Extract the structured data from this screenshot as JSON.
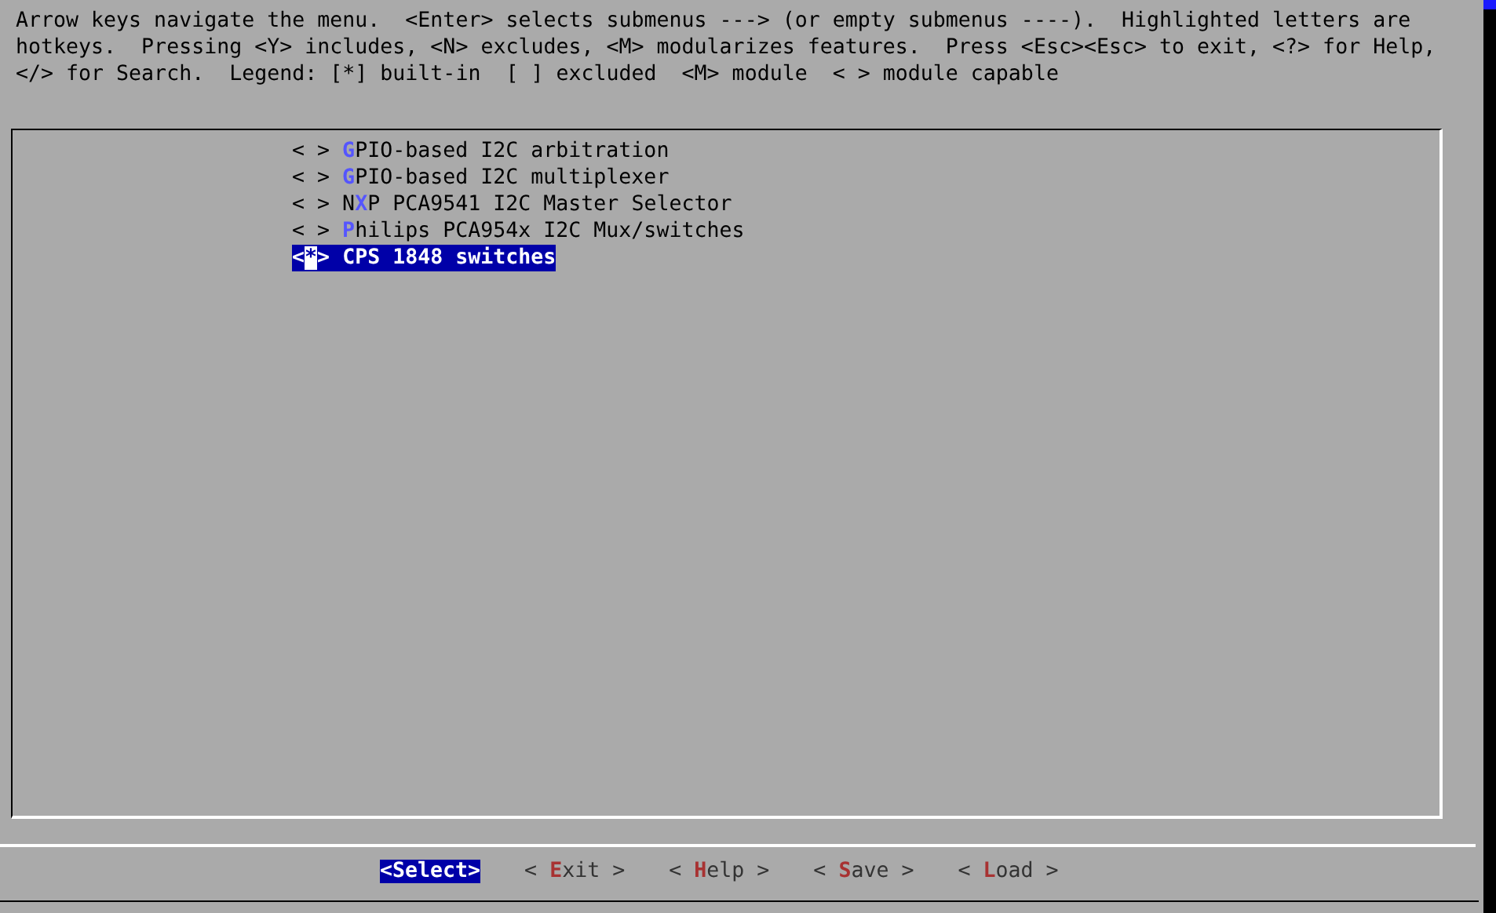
{
  "help_text": [
    "Arrow keys navigate the menu.  <Enter> selects submenus ---> (or empty submenus ----).  Highlighted letters are",
    "hotkeys.  Pressing <Y> includes, <N> excludes, <M> modularizes features.  Press <Esc><Esc> to exit, <?> for Help,",
    "</> for Search.  Legend: [*] built-in  [ ] excluded  <M> module  < > module capable"
  ],
  "menu_items": [
    {
      "marker": "< >",
      "hotkey": "G",
      "after": "PIO-based I2C arbitration",
      "selected": false
    },
    {
      "marker": "< >",
      "hotkey": "G",
      "after": "PIO-based I2C multiplexer",
      "selected": false
    },
    {
      "marker": "< >",
      "before": "N",
      "hotkey": "X",
      "after": "P PCA9541 I2C Master Selector",
      "selected": false
    },
    {
      "marker": "< >",
      "hotkey": "P",
      "after": "hilips PCA954x I2C Mux/switches",
      "selected": false
    },
    {
      "marker": "<*>",
      "after": "CPS 1848 switches",
      "selected": true
    }
  ],
  "buttons": [
    {
      "after": "<Select>",
      "selected": true
    },
    {
      "before": "< ",
      "hotkey": "E",
      "after": "xit >",
      "selected": false
    },
    {
      "before": "< ",
      "hotkey": "H",
      "after": "elp >",
      "selected": false
    },
    {
      "before": "< ",
      "hotkey": "S",
      "after": "ave >",
      "selected": false
    },
    {
      "before": "< ",
      "hotkey": "L",
      "after": "oad >",
      "selected": false
    }
  ]
}
